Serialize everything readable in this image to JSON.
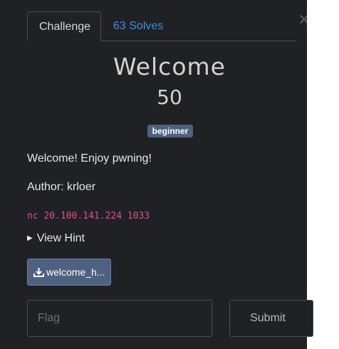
{
  "tabs": {
    "challenge": "Challenge",
    "solves": "63 Solves"
  },
  "challenge": {
    "name": "Welcome",
    "points": "50",
    "tag": "beginner",
    "description_line1": "Welcome! Enjoy pwning!",
    "description_line2": "Author: krloer",
    "connection": "nc 20.100.141.224 1033",
    "hint_label": "View Hint",
    "file_label": "welcome_h..."
  },
  "form": {
    "flag_placeholder": "Flag",
    "submit_label": "Submit"
  },
  "colors": {
    "background": "#1f2124",
    "accent": "#4e6180",
    "link": "#3d8ee6",
    "code": "#e24d8e"
  }
}
